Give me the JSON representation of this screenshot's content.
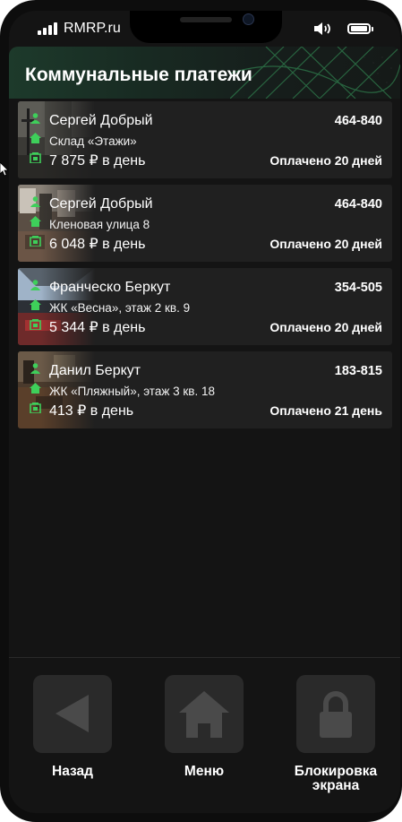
{
  "status_bar": {
    "carrier": "RMRP.ru"
  },
  "header": {
    "title": "Коммунальные платежи"
  },
  "properties": [
    {
      "owner": "Сергей Добрый",
      "address": "Склад «Этажи»",
      "price": "7 875 ₽ в день",
      "code": "464-840",
      "paid": "Оплачено 20 дней"
    },
    {
      "owner": "Сергей Добрый",
      "address": "Кленовая улица 8",
      "price": "6 048 ₽ в день",
      "code": "464-840",
      "paid": "Оплачено 20 дней"
    },
    {
      "owner": "Франческо Беркут",
      "address": "ЖК «Весна», этаж 2 кв. 9",
      "price": "5 344 ₽ в день",
      "code": "354-505",
      "paid": "Оплачено 20 дней"
    },
    {
      "owner": "Данил Беркут",
      "address": "ЖК «Пляжный», этаж 3 кв. 18",
      "price": "413 ₽ в день",
      "code": "183-815",
      "paid": "Оплачено 21 день"
    }
  ],
  "nav": {
    "back": "Назад",
    "menu": "Меню",
    "lock_line1": "Блокировка",
    "lock_line2": "экрана"
  },
  "icons": {
    "back": "back-triangle-icon",
    "menu": "home-icon",
    "lock": "padlock-icon",
    "person": "person-icon",
    "house": "house-icon",
    "money": "wallet-icon"
  },
  "colors": {
    "accent": "#3ecf5a",
    "card": "#202020",
    "button": "#2a2a2a",
    "background": "#141414"
  }
}
